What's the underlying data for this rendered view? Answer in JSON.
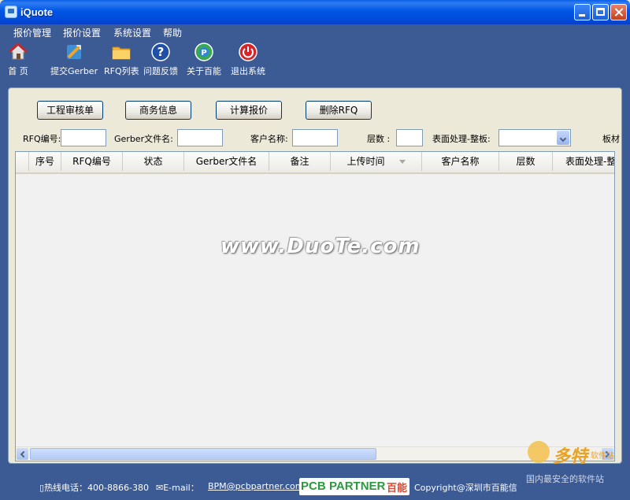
{
  "window": {
    "title": "iQuote"
  },
  "menu": [
    "报价管理",
    "报价设置",
    "系统设置",
    "帮助"
  ],
  "toolbar": [
    {
      "label": "首  页",
      "icon": "home-icon"
    },
    {
      "label": "提交Gerber",
      "icon": "submit-gerber-icon"
    },
    {
      "label": "RFQ列表",
      "icon": "folder-icon"
    },
    {
      "label": "问题反馈",
      "icon": "help-question-icon"
    },
    {
      "label": "关于百能",
      "icon": "about-icon"
    },
    {
      "label": "退出系统",
      "icon": "power-icon"
    }
  ],
  "actions": [
    "工程审核单",
    "商务信息",
    "计算报价",
    "删除RFQ"
  ],
  "filters": {
    "rfq_label": "RFQ编号:",
    "gerber_label": "Gerber文件名:",
    "customer_label": "客户名称:",
    "layers_label": "层数  :",
    "surface_label": "表面处理-整板:",
    "cut_label": "板材"
  },
  "grid": {
    "columns": [
      "序号",
      "RFQ编号",
      "状态",
      "Gerber文件名",
      "备注",
      "上传时间",
      "客户名称",
      "层数",
      "表面处理-整板"
    ],
    "rows": []
  },
  "watermark": "www.DuoTe.com",
  "status": {
    "hotline": "热线电话：400-8866-380",
    "email_label": "E-mail：",
    "email": "BPM@pcbpartner.com",
    "logo_pcb": "PCB",
    "logo_partner": "PARTNER",
    "logo_cn": "百能",
    "copyright": "Copyright@深圳市百能信"
  },
  "corner": {
    "brand": "多特",
    "sub": "软件站",
    "tagline": "国内最安全的软件站"
  },
  "colors": {
    "titlebar": "#0055e5",
    "app_bg": "#3c5a94",
    "panel_bg": "#ece9d8"
  }
}
